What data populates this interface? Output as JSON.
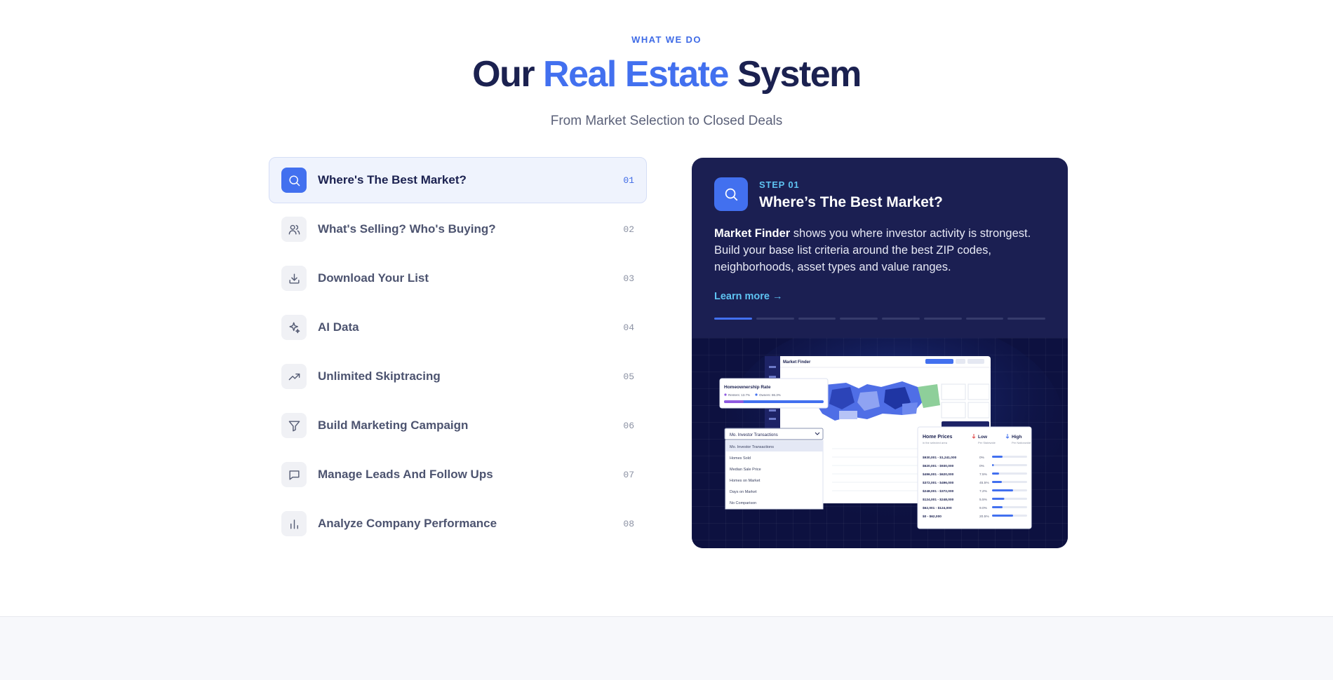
{
  "section": {
    "eyebrow": "WHAT WE DO",
    "title_pre": "Our ",
    "title_accent": "Real Estate",
    "title_post": " System",
    "subtitle": "From Market Selection to Closed Deals"
  },
  "steps": [
    {
      "label": "Where's The Best Market?",
      "number": "01",
      "icon": "search-icon",
      "active": true
    },
    {
      "label": "What's Selling? Who's Buying?",
      "number": "02",
      "icon": "users-icon"
    },
    {
      "label": "Download Your List",
      "number": "03",
      "icon": "download-icon"
    },
    {
      "label": "AI Data",
      "number": "04",
      "icon": "sparkle-icon"
    },
    {
      "label": "Unlimited Skiptracing",
      "number": "05",
      "icon": "trend-up-icon"
    },
    {
      "label": "Build Marketing Campaign",
      "number": "06",
      "icon": "filter-icon"
    },
    {
      "label": "Manage Leads And Follow Ups",
      "number": "07",
      "icon": "chat-icon"
    },
    {
      "label": "Analyze Company Performance",
      "number": "08",
      "icon": "bar-chart-icon"
    }
  ],
  "card": {
    "step_label": "STEP 01",
    "title": "Where’s The Best Market?",
    "desc_bold": "Market Finder",
    "desc_rest": " shows you where investor activity is strongest. Build your base list criteria around the best ZIP codes, neighborhoods, asset types and value ranges.",
    "learn_more": "Learn more →",
    "progress_total": 8,
    "progress_active": 1
  },
  "screenshot": {
    "app_title": "Market Finder",
    "homeownership": {
      "title": "Homeownership Rate",
      "renters": "Renters: 13.7%",
      "owners": "Owners: 86.3%"
    },
    "dropdown": {
      "selected": "Mo. Investor Transactions",
      "options": [
        "Mo. Investor Transactions",
        "Homes Sold",
        "Median Sale Price",
        "Homes on Market",
        "Days on Market",
        "No Comparison"
      ]
    },
    "home_prices": {
      "title": "Home Prices",
      "subtitle": "in the selected area",
      "low": "Low",
      "low_sub": "Per Statewide",
      "high": "High",
      "high_sub": "Per Nationwide",
      "rows": [
        {
          "range": "$930,001 - $1,241,000",
          "pct": "0%",
          "fill": 0.3
        },
        {
          "range": "$620,001 - $930,000",
          "pct": "0%",
          "fill": 0.05
        },
        {
          "range": "$496,001 - $620,000",
          "pct": "7.5%",
          "fill": 0.2
        },
        {
          "range": "$372,001 - $496,000",
          "pct": "45.5%",
          "fill": 0.28
        },
        {
          "range": "$248,001 - $372,000",
          "pct": "7.2%",
          "fill": 0.6
        },
        {
          "range": "$124,001 - $248,000",
          "pct": "5.5%",
          "fill": 0.35
        },
        {
          "range": "$62,001 - $124,000",
          "pct": "9.0%",
          "fill": 0.3
        },
        {
          "range": "$0 - $62,000",
          "pct": "20.5%",
          "fill": 0.6
        }
      ]
    }
  }
}
